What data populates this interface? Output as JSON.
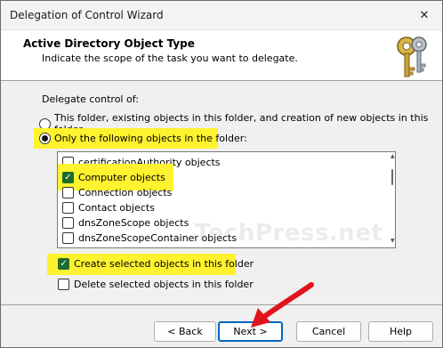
{
  "window": {
    "title": "Delegation of Control Wizard",
    "close_glyph": "✕"
  },
  "header": {
    "title": "Active Directory Object Type",
    "subtitle": "Indicate the scope of the task you want to delegate.",
    "icon": "keys-icon"
  },
  "body": {
    "delegate_label": "Delegate control of:",
    "radio_options": [
      {
        "label": "This folder, existing objects in this folder, and creation of new objects in this folder",
        "checked": false
      },
      {
        "label": "Only the following objects in the folder:",
        "checked": true
      }
    ],
    "object_list": [
      {
        "label": "certificationAuthority objects",
        "checked": false
      },
      {
        "label": "Computer objects",
        "checked": true
      },
      {
        "label": "Connection objects",
        "checked": false
      },
      {
        "label": "Contact objects",
        "checked": false
      },
      {
        "label": "dnsZoneScope objects",
        "checked": false
      },
      {
        "label": "dnsZoneScopeContainer objects",
        "checked": false
      }
    ],
    "create_selected": {
      "label": "Create selected objects in this folder",
      "checked": true
    },
    "delete_selected": {
      "label": "Delete selected objects in this folder",
      "checked": false
    },
    "watermark": "TechPress.net"
  },
  "footer": {
    "back_label": "< Back",
    "next_label": "Next >",
    "cancel_label": "Cancel",
    "help_label": "Help"
  },
  "colors": {
    "highlight": "#fff22f",
    "annotation_arrow": "#e3131b",
    "check_fill": "#1e6b2e"
  }
}
